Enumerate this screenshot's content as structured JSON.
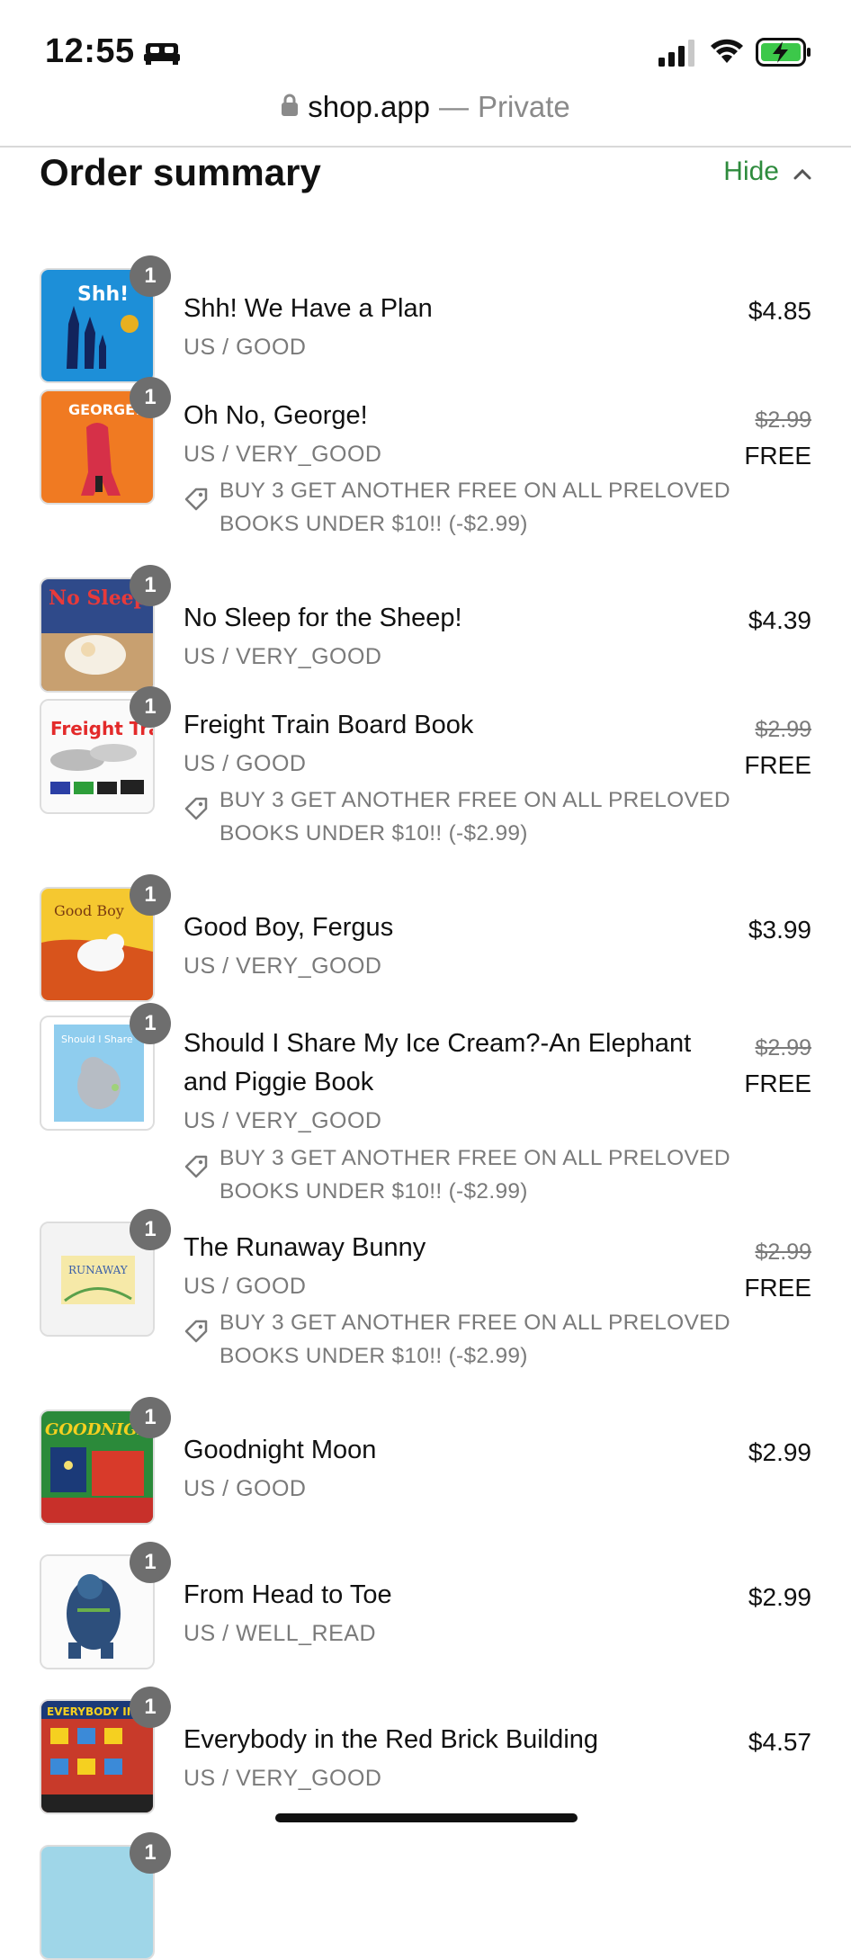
{
  "status": {
    "time": "12:55"
  },
  "browser": {
    "host": "shop.app",
    "separator": "—",
    "mode": "Private"
  },
  "summary": {
    "title": "Order summary",
    "toggle_label": "Hide"
  },
  "colors": {
    "accent": "#2e8b3d",
    "muted": "#7a7a7a"
  },
  "items": [
    {
      "title": "Shh! We Have a Plan",
      "variant": "US / GOOD",
      "price": "$4.85",
      "qty": "1"
    },
    {
      "title": "Oh No, George!",
      "variant": "US / VERY_GOOD",
      "original_price": "$2.99",
      "price": "FREE",
      "qty": "1",
      "promo": "BUY 3 GET ANOTHER FREE ON ALL PRELOVED BOOKS UNDER $10!! (-$2.99)"
    },
    {
      "title": "No Sleep for the Sheep!",
      "variant": "US / VERY_GOOD",
      "price": "$4.39",
      "qty": "1"
    },
    {
      "title": "Freight Train Board Book",
      "variant": "US / GOOD",
      "original_price": "$2.99",
      "price": "FREE",
      "qty": "1",
      "promo": "BUY 3 GET ANOTHER FREE ON ALL PRELOVED BOOKS UNDER $10!! (-$2.99)"
    },
    {
      "title": "Good Boy, Fergus",
      "variant": "US / VERY_GOOD",
      "price": "$3.99",
      "qty": "1"
    },
    {
      "title": "Should I Share My Ice Cream?-An Elephant and Piggie Book",
      "variant": "US / VERY_GOOD",
      "original_price": "$2.99",
      "price": "FREE",
      "qty": "1",
      "promo": "BUY 3 GET ANOTHER FREE ON ALL PRELOVED BOOKS UNDER $10!! (-$2.99)"
    },
    {
      "title": "The Runaway Bunny",
      "variant": "US / GOOD",
      "original_price": "$2.99",
      "price": "FREE",
      "qty": "1",
      "promo": "BUY 3 GET ANOTHER FREE ON ALL PRELOVED BOOKS UNDER $10!! (-$2.99)"
    },
    {
      "title": "Goodnight Moon",
      "variant": "US / GOOD",
      "price": "$2.99",
      "qty": "1"
    },
    {
      "title": "From Head to Toe",
      "variant": "US / WELL_READ",
      "price": "$2.99",
      "qty": "1"
    },
    {
      "title": "Everybody in the Red Brick Building",
      "variant": "US / VERY_GOOD",
      "price": "$4.57",
      "qty": "1"
    },
    {
      "qty": "1"
    }
  ]
}
